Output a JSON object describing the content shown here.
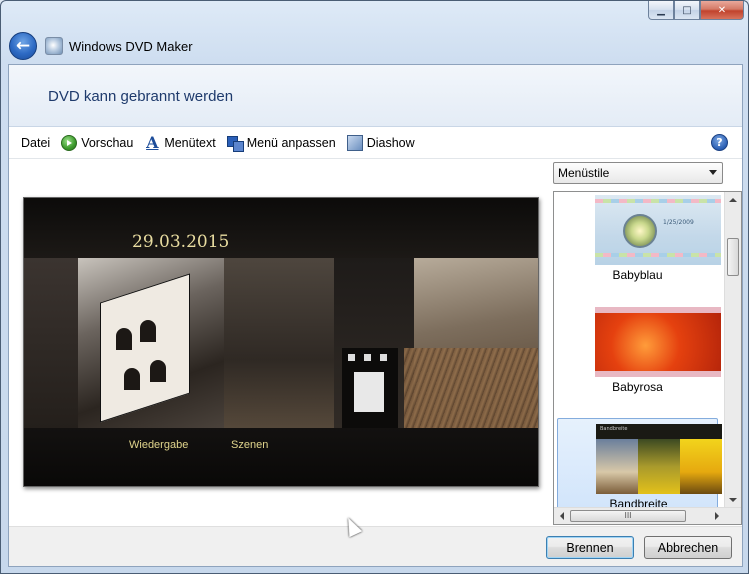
{
  "window": {
    "title": "Windows DVD Maker",
    "minimize_glyph": "▁",
    "maximize_glyph": "□",
    "close_glyph": "✕"
  },
  "header": {
    "heading": "DVD kann gebrannt werden"
  },
  "toolbar": {
    "items": [
      {
        "label": "Datei"
      },
      {
        "label": "Vorschau",
        "icon": "play-icon"
      },
      {
        "label": "Menütext",
        "icon": "text-icon"
      },
      {
        "label": "Menü anpassen",
        "icon": "customize-icon"
      },
      {
        "label": "Diashow",
        "icon": "slideshow-icon"
      }
    ],
    "help_glyph": "?"
  },
  "preview": {
    "date": "29.03.2015",
    "links": [
      "Wiedergabe",
      "Szenen"
    ]
  },
  "styles_panel": {
    "dropdown_value": "Menüstile",
    "items": [
      {
        "label": "Babyblau",
        "thumb_date": "1/25/2009"
      },
      {
        "label": "Babyrosa"
      },
      {
        "label": "Bandbreite",
        "selected": true,
        "thumb_caption": "Bandbreite"
      }
    ],
    "hscroll_grip": "III"
  },
  "footer": {
    "burn_label": "Brennen",
    "cancel_label": "Abbrechen"
  },
  "colors": {
    "heading": "#1e3a6c",
    "preview_text": "#e0d48c",
    "selection": "#cfe3fb"
  }
}
